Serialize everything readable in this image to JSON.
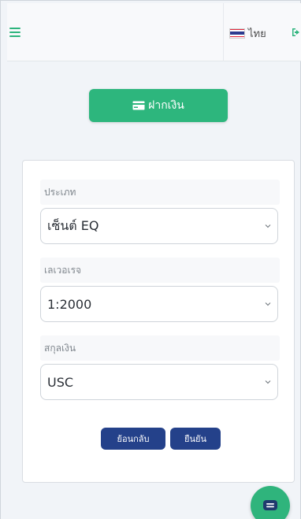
{
  "topbar": {
    "menu_icon": "hamburger-menu-icon",
    "language_label": "ไทย",
    "language_flag": "thailand-flag-icon",
    "logout_icon": "sign-out-icon"
  },
  "deposit": {
    "label": "ฝากเงิน",
    "icon": "credit-card-icon"
  },
  "form": {
    "type": {
      "label": "ประเภท",
      "value": "เซ็นต์ EQ"
    },
    "leverage": {
      "label": "เลเวอเรจ",
      "value": "1:2000"
    },
    "currency": {
      "label": "สกุลเงิน",
      "value": "USC"
    }
  },
  "actions": {
    "back_label": "ย้อนกลับ",
    "confirm_label": "ยืนยัน"
  },
  "chat": {
    "icon": "chat-bubble-icon"
  },
  "colors": {
    "accent_green": "#2db67d",
    "button_navy": "#24418a"
  }
}
